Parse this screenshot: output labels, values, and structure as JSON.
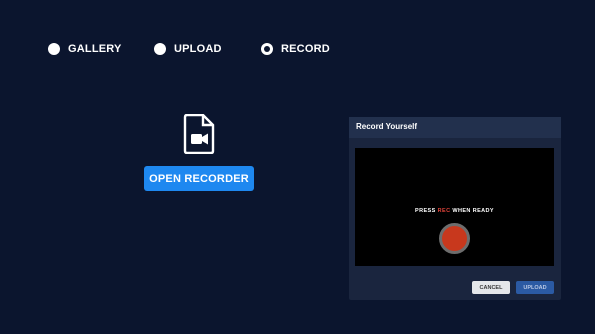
{
  "source_options": [
    {
      "label": "GALLERY",
      "selected": false
    },
    {
      "label": "UPLOAD",
      "selected": false
    },
    {
      "label": "RECORD",
      "selected": true
    }
  ],
  "main": {
    "icon": "video-file-icon",
    "open_recorder_label": "OPEN RECORDER"
  },
  "recorder_panel": {
    "title": "Record Yourself",
    "message_prefix": "PRESS",
    "message_rec": "REC",
    "message_suffix": "WHEN READY",
    "rec_icon": "record-icon",
    "cancel_label": "CANCEL",
    "upload_label": "UPLOAD"
  },
  "colors": {
    "background": "#0b152e",
    "accent": "#1e88f0",
    "record_red": "#c8381d"
  }
}
